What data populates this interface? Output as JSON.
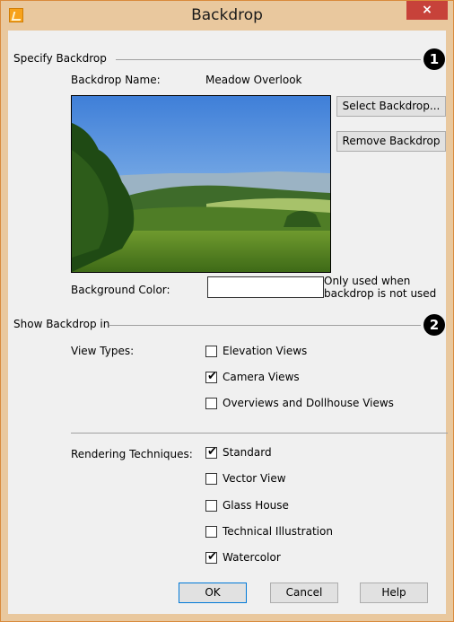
{
  "window": {
    "title": "Backdrop",
    "close_glyph": "×",
    "app_icon": "app-icon"
  },
  "specify": {
    "section_label": "Specify Backdrop",
    "callout": "1",
    "name_label": "Backdrop Name:",
    "name_value": "Meadow Overlook",
    "select_button": "Select Backdrop...",
    "remove_button": "Remove Backdrop",
    "background_color_label": "Background Color:",
    "background_color_value": "#ffffff",
    "note_line1": "Only used when",
    "note_line2": "backdrop is not used"
  },
  "show": {
    "section_label": "Show Backdrop in",
    "callout": "2",
    "view_types_label": "View Types:",
    "view_types": [
      {
        "label": "Elevation Views",
        "checked": false
      },
      {
        "label": "Camera Views",
        "checked": true
      },
      {
        "label": "Overviews and Dollhouse Views",
        "checked": false
      }
    ],
    "rendering_label": "Rendering Techniques:",
    "rendering": [
      {
        "label": "Standard",
        "checked": true
      },
      {
        "label": "Vector View",
        "checked": false
      },
      {
        "label": "Glass House",
        "checked": false
      },
      {
        "label": "Technical Illustration",
        "checked": false
      },
      {
        "label": "Watercolor",
        "checked": true
      }
    ]
  },
  "buttons": {
    "ok": "OK",
    "cancel": "Cancel",
    "help": "Help"
  },
  "check_glyph": "✔"
}
